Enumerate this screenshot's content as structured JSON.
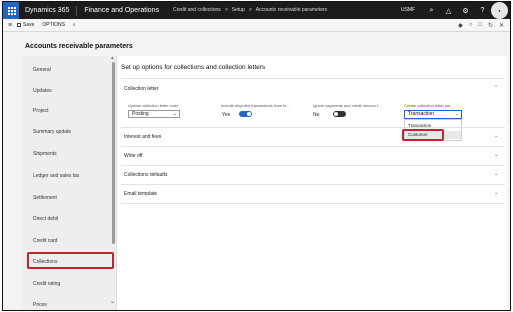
{
  "topbar": {
    "brand": "Dynamics 365",
    "module": "Finance and Operations",
    "breadcrumbs": [
      "Credit and collections",
      ">",
      "Setup",
      ">",
      "Accounts receivable parameters"
    ],
    "company": "USMF",
    "icons": [
      "search-icon",
      "bell-icon",
      "gear-icon",
      "help-icon",
      "avatar"
    ]
  },
  "actionbar": {
    "save": "Save",
    "options": "OPTIONS"
  },
  "page": {
    "title": "Accounts receivable parameters",
    "subtitle": "Set up options for collections and collection letters"
  },
  "nav": {
    "items": [
      "General",
      "Updates",
      "Project",
      "Summary update",
      "Shipments",
      "Ledger and sales tax",
      "Settlement",
      "Direct debit",
      "Credit card",
      "Collections",
      "Credit rating",
      "Prices"
    ],
    "selected": "Collections"
  },
  "sections": {
    "collection_letter": "Collection letter",
    "interest_and_fees": "Interest and fees",
    "write_off": "Write off",
    "collections_defaults": "Collections defaults",
    "email_template": "Email template"
  },
  "fields": {
    "update_letter_code_label": "Update collection letter code",
    "update_letter_code_value": "Posting",
    "include_disputed_label": "Include disputed transactions from fo...",
    "include_disputed_value": "Yes",
    "ignore_payments_label": "Ignore payments and credit memos f...",
    "ignore_payments_value": "No",
    "create_letters_per_label": "Create collection letter per",
    "create_letters_per_value": "Transaction",
    "create_letters_per_options": [
      "Transaction",
      "Customer"
    ]
  },
  "colors": {
    "topbar": "#1c1c1c",
    "accent": "#2266c8",
    "highlight": "#c8202e",
    "toggle_on": "#2266c8",
    "toggle_off": "#333333"
  }
}
